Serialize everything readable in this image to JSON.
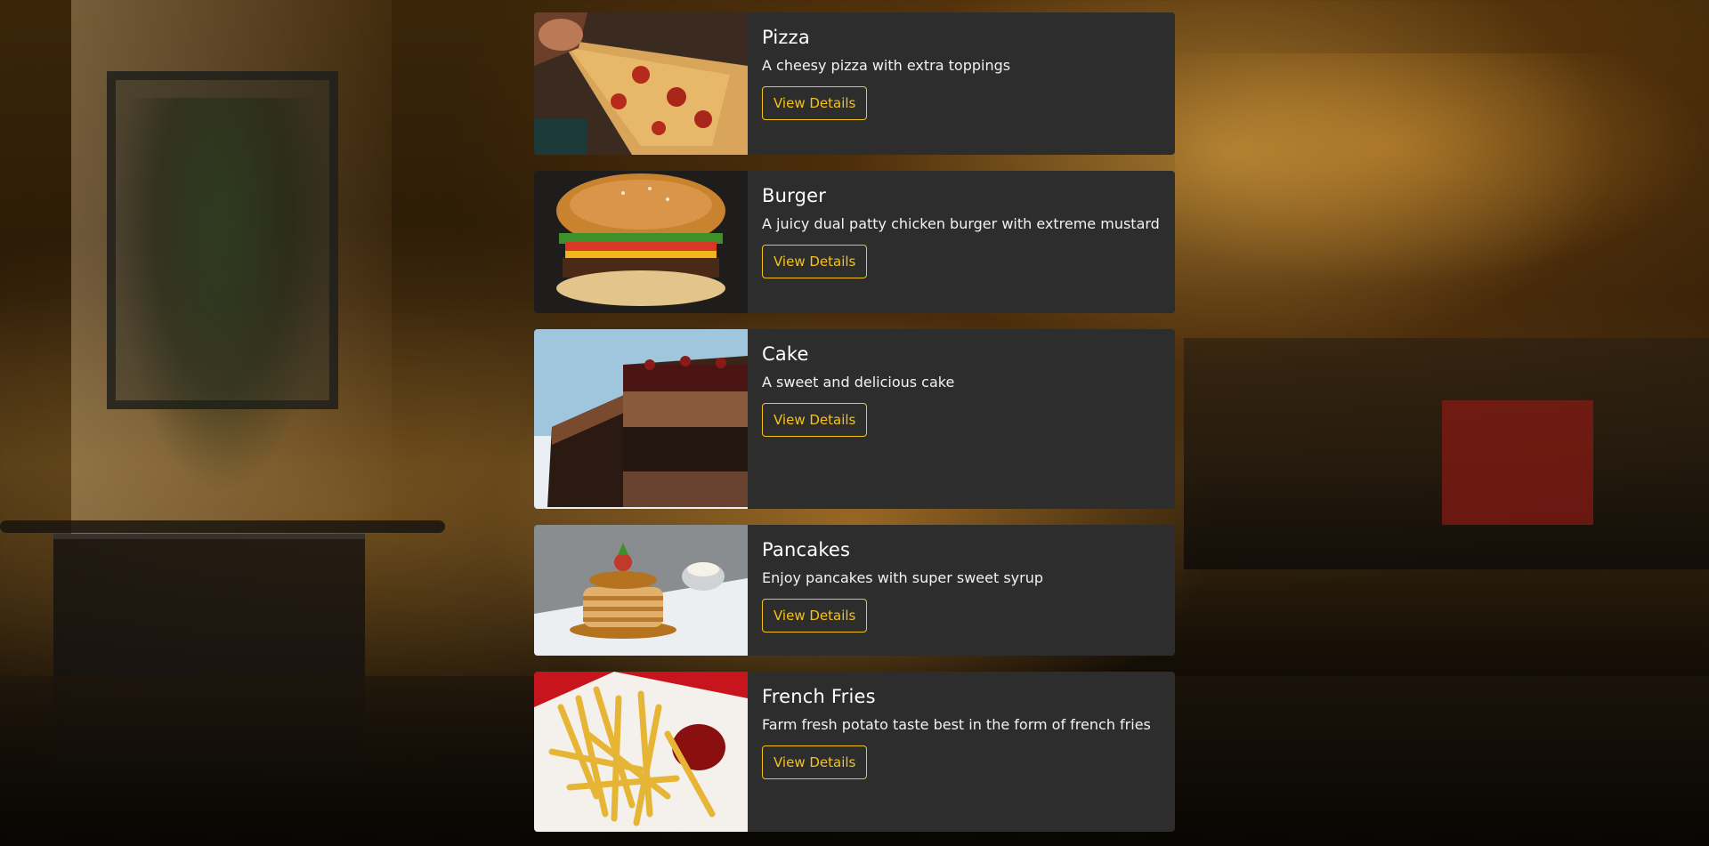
{
  "menu": {
    "button_label": "View Details",
    "items": [
      {
        "title": "Pizza",
        "description": "A cheesy pizza with extra toppings",
        "image_icon": "pizza-image"
      },
      {
        "title": "Burger",
        "description": "A juicy dual patty chicken burger with extreme mustard",
        "image_icon": "burger-image"
      },
      {
        "title": "Cake",
        "description": "A sweet and delicious cake",
        "image_icon": "cake-image"
      },
      {
        "title": "Pancakes",
        "description": "Enjoy pancakes with super sweet syrup",
        "image_icon": "pancakes-image"
      },
      {
        "title": "French Fries",
        "description": "Farm fresh potato taste best in the form of french fries",
        "image_icon": "french-fries-image"
      }
    ]
  },
  "colors": {
    "card_background": "#2d2d2d",
    "accent": "#f5c21b",
    "text": "#ffffff"
  }
}
